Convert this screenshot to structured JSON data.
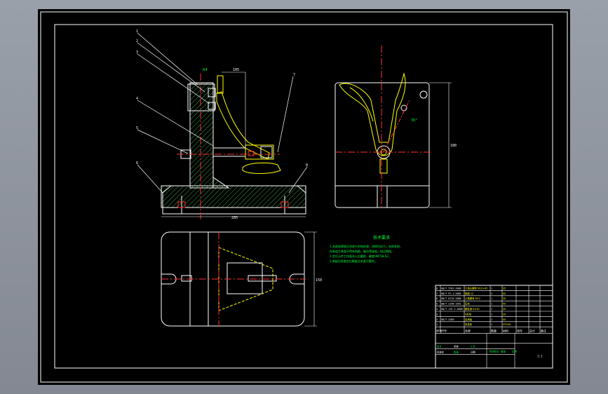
{
  "drawing": {
    "tech_req_title": "技术要求",
    "tech_req_lines": [
      "1.夹具体焊接后须进行时效处理，消除内应力，去除毛刺，",
      "  所有加工表面不得有划痕、碰伤等缺陷，锐边倒钝。",
      "2.定位元件工作面淬火后磨削，硬度HRC58-62。",
      "3.装配后检查定位精度及夹紧可靠性。"
    ],
    "dim_top": "105",
    "dim_base": "285",
    "dim_side": "R4",
    "dim_right": "180",
    "dim_plan": "150",
    "dim_angle": "30°",
    "balloons": [
      "1",
      "2",
      "3",
      "4",
      "5",
      "6",
      "7",
      "8"
    ],
    "title_block": {
      "header": [
        "序号",
        "代号",
        "名称",
        "数量",
        "材料",
        "单件",
        "总计",
        "备注"
      ],
      "rows": [
        [
          "8",
          "GB/T 5782-2000",
          "六角头螺栓 M12×45",
          "1",
          "35"
        ],
        [
          "7",
          "GB/T 97.1-2002",
          "垫圈 12",
          "2",
          "45"
        ],
        [
          "6",
          "GB/T 6170-2000",
          "六角螺母 M12",
          "1",
          "35"
        ],
        [
          "5",
          "GB/T 2148-1991",
          "压块",
          "1",
          "45"
        ],
        [
          "4",
          "GB/T 119.1-2000",
          "圆柱销 8×30",
          "2",
          "35"
        ],
        [
          "3",
          "",
          "V形块",
          "1",
          "20"
        ],
        [
          "2",
          "GB/T 2189",
          "支承板",
          "2",
          "45"
        ],
        [
          "1",
          "",
          "夹具体",
          "1",
          "HT200"
        ]
      ],
      "sign_cells": [
        "设计",
        "审核",
        "工艺",
        "标准化",
        "批准",
        "日期"
      ],
      "stage_cells": [
        "阶段标记",
        "重量",
        "比例"
      ],
      "scale": "1:1"
    }
  }
}
